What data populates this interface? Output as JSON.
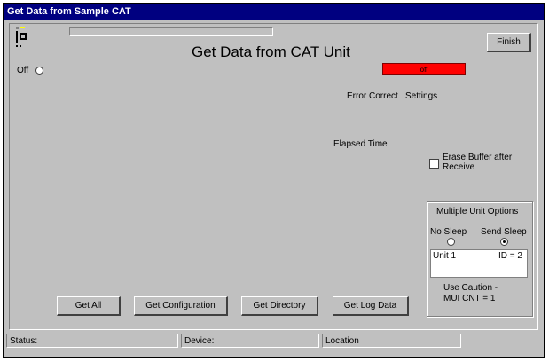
{
  "window": {
    "title": "Get Data from  Sample CAT"
  },
  "header": {
    "title": "Get Data from CAT Unit"
  },
  "buttons": {
    "finish": "Finish",
    "get_all": "Get All",
    "get_configuration": "Get Configuration",
    "get_directory": "Get Directory",
    "get_log_data": "Get Log Data"
  },
  "off_indicator": {
    "label": "Off"
  },
  "status_indicator": {
    "text": "off",
    "color": "#ff0000"
  },
  "labels": {
    "error_correct": "Error Correct",
    "settings": "Settings",
    "elapsed_time": "Elapsed Time"
  },
  "erase_buffer": {
    "label_line1": "Erase Buffer after",
    "label_line2": "Receive",
    "checked": false
  },
  "multi_unit": {
    "title": "Multiple Unit Options",
    "no_sleep": "No Sleep",
    "send_sleep": "Send Sleep",
    "selected": "send_sleep",
    "unit_name": "Unit 1",
    "unit_id": "ID = 2",
    "caution_line1": "Use Caution  -",
    "caution_line2": "MUI CNT = 1"
  },
  "statusbar": {
    "status": "Status:",
    "device": "Device:",
    "location": "Location"
  },
  "colors": {
    "titlebar": "#000080",
    "face": "#c0c0c0",
    "indicator": "#ff0000"
  }
}
